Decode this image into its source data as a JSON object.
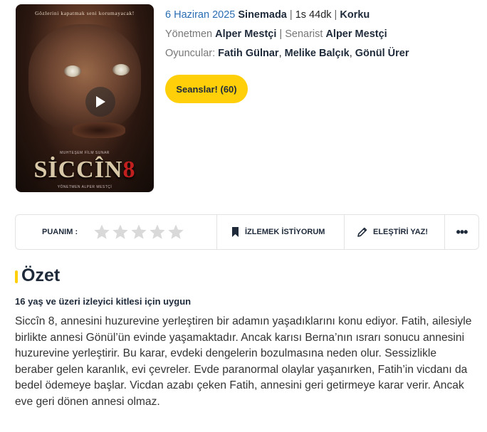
{
  "poster": {
    "tagline": "Gözlerini kapatmak seni korumayacak!",
    "presents": "MUHTEŞEM FİLM SUNAR",
    "logo_text": "SİCCÎN",
    "logo_number": "8",
    "credit": "YÖNETMEN ALPER MESTÇİ",
    "play_icon": "play-icon"
  },
  "meta": {
    "release_date": "6 Haziran 2025",
    "status": "Sinemada",
    "duration": "1s 44dk",
    "genre": "Korku",
    "separator": "|",
    "director_label": "Yönetmen",
    "director": "Alper Mestçi",
    "writer_label": "Senarist",
    "writer": "Alper Mestçi",
    "cast_label": "Oyuncular:",
    "cast": [
      "Fatih Gülnar",
      "Melike Balçık",
      "Gönül Ürer"
    ],
    "comma": ","
  },
  "seans_button": "Seanslar! (60)",
  "actions": {
    "rating_label": "PUANIM :",
    "stars_count": 5,
    "rating_value": 0,
    "watchlist_label": "İZLEMEK İSTİYORUM",
    "review_label": "ELEŞTİRİ YAZ!",
    "more_label": "•••"
  },
  "summary": {
    "heading": "Özet",
    "age_rating": "16 yaş ve üzeri izleyici kitlesi için uygun",
    "text": "Siccîn 8, annesini huzurevine yerleştiren bir adamın yaşadıklarını konu ediyor. Fatih, ailesiyle birlikte annesi Gönül’ün evinde yaşamaktadır. Ancak karısı Berna’nın ısrarı sonucu annesini huzurevine yerleştirir. Bu karar, evdeki dengelerin bozulmasına neden olur. Sessizlikle beraber gelen karanlık, evi çevreler. Evde paranormal olaylar yaşanırken, Fatih’in vicdanı da bedel ödemeye başlar. Vicdan azabı çeken Fatih, annesini geri getirmeye karar verir. Ancak eve geri dönen annesi olmaz."
  },
  "colors": {
    "accent": "#ffcf0a",
    "link_blue": "#2a6db3",
    "star_empty": "#d9d9d9",
    "dark_text": "#1e2a3a"
  }
}
